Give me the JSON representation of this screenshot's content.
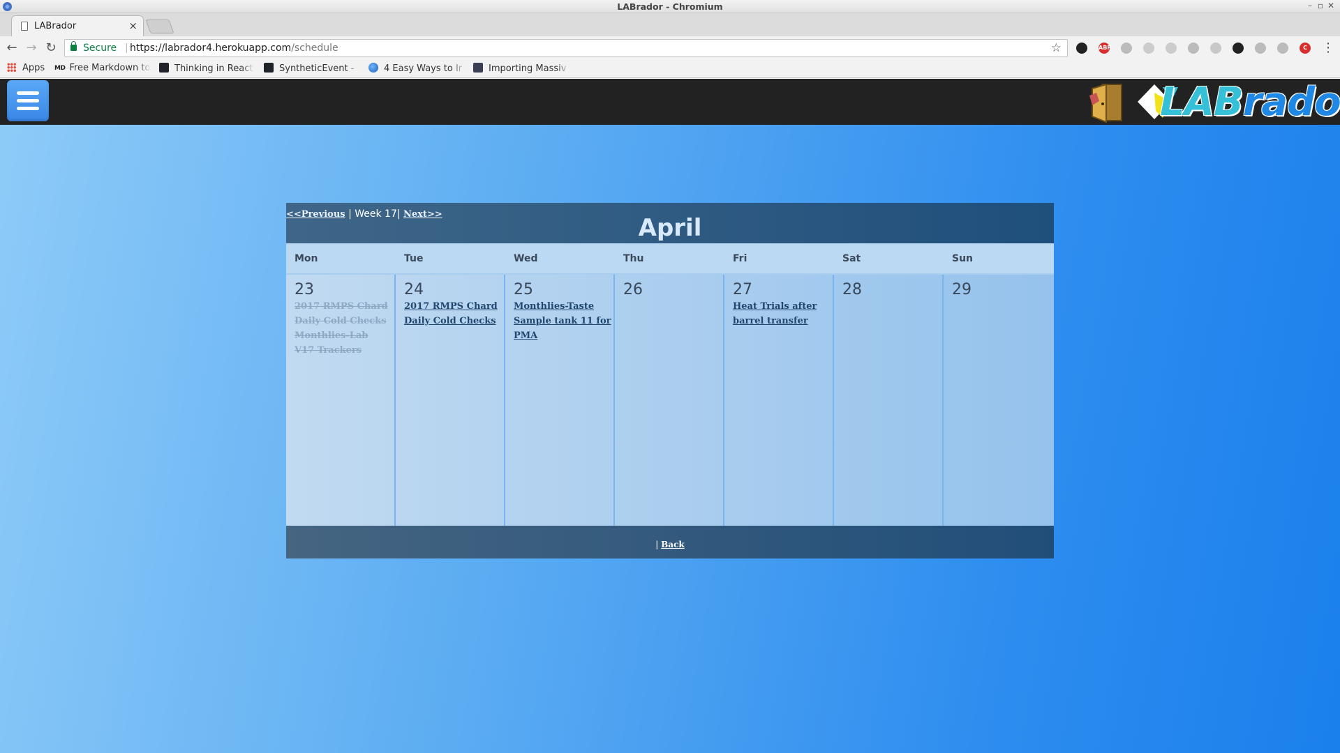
{
  "browser": {
    "window_title": "LABrador - Chromium",
    "tab_title": "LABrador",
    "tab_close": "×",
    "url_secure_label": "Secure",
    "url_separator": "|",
    "url_base": "https://labrador4.herokuapp.com",
    "url_path": "/schedule",
    "window_controls": {
      "minimize": "–",
      "restore": "▫",
      "close": "✕"
    },
    "nav": {
      "back": "←",
      "forward": "→",
      "reload": "↻",
      "star": "☆",
      "menu": "⋮"
    },
    "bookmarks": [
      {
        "label": "Apps",
        "icon": "apps-grid-icon"
      },
      {
        "label": "Free Markdown to",
        "icon": "md-icon",
        "badge": "MD"
      },
      {
        "label": "Thinking in React",
        "icon": "react-icon"
      },
      {
        "label": "SyntheticEvent -",
        "icon": "react-icon"
      },
      {
        "label": "4 Easy Ways to Ir",
        "icon": "globe-icon"
      },
      {
        "label": "Importing Massiv",
        "icon": "avatar-icon"
      }
    ],
    "extensions": [
      {
        "name": "squirrel-extension-icon",
        "color": "#222222",
        "text": ""
      },
      {
        "name": "adblock-extension-icon",
        "color": "#d82e2e",
        "text": "ABP"
      },
      {
        "name": "trash-extension-icon",
        "color": "#bbbbbb",
        "text": ""
      },
      {
        "name": "frame-extension-icon",
        "color": "#cccccc",
        "text": ""
      },
      {
        "name": "snowflake-extension-icon",
        "color": "#cccccc",
        "text": ""
      },
      {
        "name": "gear-extension-icon",
        "color": "#bbbbbb",
        "text": ""
      },
      {
        "name": "circle-extension-icon",
        "color": "#c8c8c8",
        "text": ""
      },
      {
        "name": "magnifier-extension-icon",
        "color": "#222222",
        "text": ""
      },
      {
        "name": "cast-extension-icon",
        "color": "#bbbbbb",
        "text": ""
      },
      {
        "name": "link-extension-icon",
        "color": "#bbbbbb",
        "text": ""
      },
      {
        "name": "red-c-extension-icon",
        "color": "#d82e2e",
        "text": "C"
      }
    ]
  },
  "app": {
    "logo_text_lab": "LAB",
    "logo_text_rest": "rador",
    "colors": {
      "header": "#222222",
      "menu_button": "#3a86e6",
      "logo_blue": "#1f88e5",
      "logo_cyan": "#35c0d8"
    }
  },
  "calendar": {
    "prev_label": "<<Previous",
    "week_label": " | Week 17| ",
    "next_label": "Next>>",
    "month": "April",
    "days": [
      {
        "name": "Mon",
        "date": "23",
        "events": [
          {
            "title": "2017 RMPS Chard",
            "done": true
          },
          {
            "title": "Daily Cold Checks",
            "done": true
          },
          {
            "title": "Monthlies-Lab",
            "done": true
          },
          {
            "title": "V17 Trackers",
            "done": true
          }
        ]
      },
      {
        "name": "Tue",
        "date": "24",
        "events": [
          {
            "title": "2017 RMPS Chard",
            "done": false
          },
          {
            "title": "Daily Cold Checks",
            "done": false
          }
        ]
      },
      {
        "name": "Wed",
        "date": "25",
        "events": [
          {
            "title": "Monthlies-Taste Sample tank 11 for PMA",
            "done": false
          }
        ]
      },
      {
        "name": "Thu",
        "date": "26",
        "events": []
      },
      {
        "name": "Fri",
        "date": "27",
        "events": [
          {
            "title": "Heat Trials after barrel transfer",
            "done": false
          }
        ]
      },
      {
        "name": "Sat",
        "date": "28",
        "events": []
      },
      {
        "name": "Sun",
        "date": "29",
        "events": []
      }
    ],
    "footer_separator": "| ",
    "back_label": "Back"
  }
}
